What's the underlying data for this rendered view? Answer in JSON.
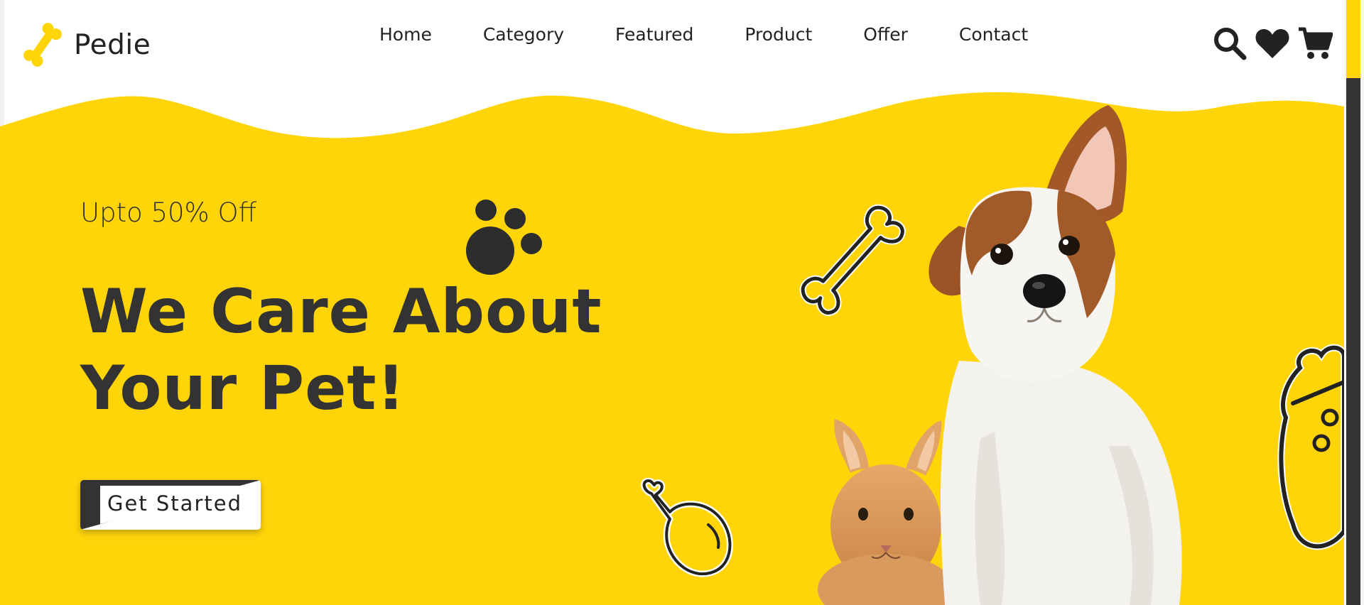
{
  "brand": {
    "name": "Pedie",
    "accent": "#FFD50A",
    "dark": "#333333"
  },
  "nav": {
    "items": [
      {
        "label": "Home"
      },
      {
        "label": "Category"
      },
      {
        "label": "Featured"
      },
      {
        "label": "Product"
      },
      {
        "label": "Offer"
      },
      {
        "label": "Contact"
      }
    ]
  },
  "header_icons": [
    "search-icon",
    "heart-icon",
    "cart-icon"
  ],
  "hero": {
    "offer": "Upto 50% Off",
    "headline_line1": "We Care About",
    "headline_line2": "Your Pet!",
    "cta_label": "Get Started"
  }
}
